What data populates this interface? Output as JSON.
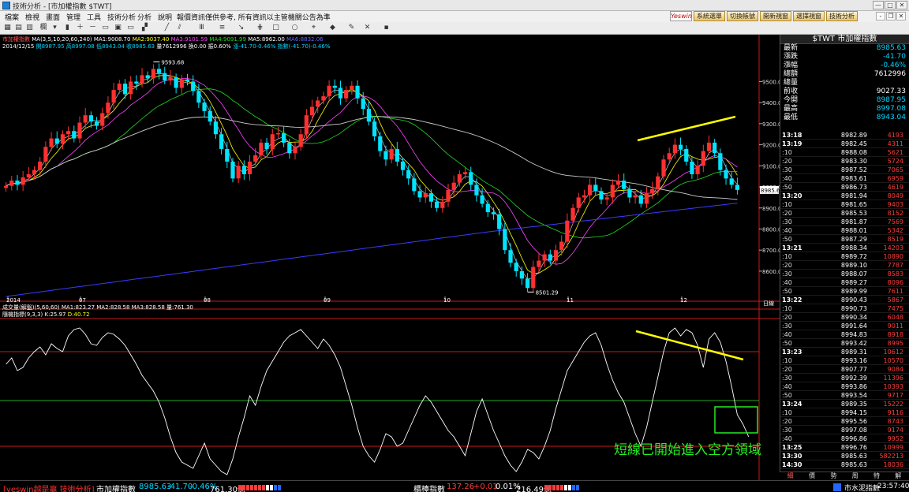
{
  "window": {
    "title": "技術分析 - [市加權指數 $TWT]",
    "buttons": [
      "—",
      "□",
      "✕"
    ]
  },
  "menu": {
    "items": [
      "檔案",
      "檢視",
      "畫面",
      "管理",
      "工具",
      "技術分析",
      "分析",
      "說明"
    ],
    "notice": "報價資訊僅供參考, 所有資訊以主管機關公告為準",
    "brand": "Yeswin",
    "top_buttons": [
      "系統選單",
      "切換帳號",
      "開新視窗",
      "選擇視窗",
      "技術分析"
    ],
    "mdi_buttons": [
      "-",
      "❐",
      "✕"
    ]
  },
  "toolbar": {
    "icons": [
      "grid-icon",
      "table-icon",
      "chart-icon",
      "candle-icon",
      "zoom-in-icon",
      "zoom-out-icon",
      "line-tool-icon",
      "parallel-tool-icon",
      "text-tool-icon",
      "grid-lines-icon",
      "arrow-tool-icon",
      "fibonacci-icon",
      "rect-tool-icon",
      "circle-tool-icon",
      "save-icon"
    ],
    "period_label": "欄"
  },
  "chart_header": {
    "name": "市加權指數",
    "ma_legend": [
      {
        "text": "MA(3,5,10,20,60,240)",
        "color": "#ffffff"
      },
      {
        "text": "MA1:9008.70",
        "color": "#ffffff"
      },
      {
        "text": "MA2:9037.40",
        "color": "#ffff00"
      },
      {
        "text": "MA3:9101.59",
        "color": "#ff44ff"
      },
      {
        "text": "MA4:9091.99",
        "color": "#22dd22"
      },
      {
        "text": "MA5:8962.00",
        "color": "#ffffff"
      },
      {
        "text": "MA6:8832.06",
        "color": "#4444ff"
      }
    ],
    "ohlc": {
      "date": "2014/12/15",
      "open": "開8987.95",
      "high": "高8997.08",
      "low": "低8943.04",
      "close": "收8985.63",
      "volume": "量7612996",
      "turnover": "換0.00",
      "amp": "振0.60%",
      "change": "漲-41.70-0.46%",
      "index_change": "指數(-41.70)-0.46%"
    },
    "volume_legend": [
      {
        "text": "成交量(解盤)(5,60,60)",
        "color": "#ffffff"
      },
      {
        "text": "MA1:823.27",
        "color": "#ffffff"
      },
      {
        "text": "MA2:828.58",
        "color": "#ffffff"
      },
      {
        "text": "MA3:828.58",
        "color": "#ffffff"
      },
      {
        "text": "量:761.30",
        "color": "#ffffff"
      }
    ],
    "kd_legend": [
      {
        "text": "隨機指標(9,3,3)",
        "color": "#ffffff"
      },
      {
        "text": "K:25.97",
        "color": "#ffffff"
      },
      {
        "text": "D:40.72",
        "color": "#ffff00"
      }
    ]
  },
  "chart_data": {
    "type": "candlestick",
    "y_axis": {
      "ticks": [
        9500,
        9400,
        9300,
        9200,
        9100,
        9000,
        8900,
        8800,
        8700,
        8600
      ],
      "labels": [
        "9500.0",
        "9400.0",
        "9300.0",
        "9200.0",
        "9100.0",
        "9000.0",
        "8900.0",
        "8800.0",
        "8700.0",
        "8600.0"
      ],
      "range": [
        8480,
        9640
      ]
    },
    "x_axis": {
      "labels": [
        "2014",
        "07",
        "08",
        "09",
        "10",
        "11",
        "12"
      ],
      "unit_label": "日線"
    },
    "annotations": {
      "high": "9593.68",
      "low": "8501.29",
      "last_price_tag": "8985.63"
    },
    "close": [
      9005,
      9030,
      9010,
      9045,
      9060,
      9080,
      9120,
      9190,
      9230,
      9205,
      9250,
      9265,
      9230,
      9305,
      9340,
      9310,
      9290,
      9350,
      9400,
      9460,
      9490,
      9440,
      9500,
      9490,
      9530,
      9515,
      9560,
      9540,
      9505,
      9520,
      9470,
      9510,
      9500,
      9455,
      9400,
      9360,
      9310,
      9250,
      9180,
      9120,
      9040,
      9100,
      9060,
      9120,
      9150,
      9210,
      9180,
      9250,
      9255,
      9210,
      9160,
      9190,
      9250,
      9340,
      9380,
      9410,
      9430,
      9480,
      9470,
      9420,
      9460,
      9480,
      9420,
      9370,
      9310,
      9240,
      9170,
      9130,
      9180,
      9120,
      9080,
      9040,
      8980,
      8950,
      8970,
      8930,
      8900,
      8930,
      8985,
      9020,
      9060,
      9070,
      9010,
      8960,
      8920,
      8880,
      8870,
      8800,
      8700,
      8640,
      8600,
      8565,
      8520,
      8620,
      8650,
      8680,
      8650,
      8700,
      8740,
      8840,
      8900,
      8950,
      8960,
      9010,
      8980,
      8940,
      8950,
      9010,
      9030,
      8990,
      8950,
      8960,
      8920,
      8970,
      8990,
      9050,
      9130,
      9160,
      9200,
      9180,
      9120,
      9060,
      9100,
      9170,
      9210,
      9160,
      9080,
      9040,
      9010,
      8985.63
    ],
    "series": [
      {
        "name": "MA1",
        "color": "#ffffff"
      },
      {
        "name": "MA2",
        "color": "#ffff00"
      },
      {
        "name": "MA3",
        "color": "#ff44ff"
      },
      {
        "name": "MA4",
        "color": "#22dd22"
      },
      {
        "name": "MA5",
        "color": "#ffffff"
      },
      {
        "name": "MA6",
        "color": "#4444ff"
      }
    ],
    "kd": {
      "range": [
        0,
        100
      ],
      "levels": [
        80,
        50,
        20
      ],
      "k": [
        72,
        76,
        68,
        70,
        76,
        80,
        83,
        78,
        85,
        82,
        80,
        90,
        94,
        95,
        91,
        85,
        84,
        89,
        92,
        91,
        88,
        84,
        78,
        72,
        65,
        60,
        55,
        48,
        38,
        26,
        16,
        10,
        8,
        6,
        14,
        22,
        12,
        8,
        4,
        2,
        12,
        26,
        38,
        52,
        46,
        58,
        68,
        74,
        80,
        86,
        90,
        92,
        94,
        90,
        86,
        82,
        88,
        84,
        78,
        70,
        58,
        46,
        32,
        20,
        14,
        10,
        18,
        28,
        26,
        20,
        22,
        30,
        38,
        46,
        52,
        48,
        42,
        36,
        30,
        26,
        20,
        14,
        28,
        42,
        50,
        40,
        30,
        22,
        14,
        8,
        4,
        10,
        18,
        16,
        12,
        20,
        30,
        44,
        56,
        68,
        74,
        80,
        86,
        90,
        92,
        84,
        72,
        62,
        54,
        48,
        38,
        28,
        20,
        32,
        48,
        64,
        80,
        92,
        95,
        90,
        94,
        92,
        84,
        70,
        88,
        92,
        86,
        74,
        58,
        40,
        34,
        26
      ],
      "last_k": 25.97,
      "last_d": 40.72
    }
  },
  "annotation_text": "短線已開始進入空方領域",
  "right_panel": {
    "title": "$TWT  市加權指數",
    "quotes": [
      {
        "label": "最新",
        "value": "8985.63",
        "color": "#00d7ff"
      },
      {
        "label": "漲跌",
        "value": "-41.70",
        "color": "#00d7ff"
      },
      {
        "label": "漲幅",
        "value": "-0.46%",
        "color": "#00d7ff"
      },
      {
        "label": "總額",
        "value": "7612996",
        "color": "#ffffff"
      },
      {
        "label": "總量",
        "value": "",
        "color": "#ffffff"
      },
      {
        "label": "前收",
        "value": "9027.33",
        "color": "#ffffff"
      },
      {
        "label": "今開",
        "value": "8987.95",
        "color": "#00d7ff"
      },
      {
        "label": "最高",
        "value": "8997.08",
        "color": "#00d7ff"
      },
      {
        "label": "最低",
        "value": "8943.04",
        "color": "#00d7ff"
      }
    ],
    "ticks": [
      {
        "t": "13:18",
        "p": "8982.89",
        "v": "4193",
        "major": true
      },
      {
        "t": "13:19",
        "p": "8982.45",
        "v": "4311",
        "major": true
      },
      {
        "t": ":10",
        "p": "8988.08",
        "v": "5621"
      },
      {
        "t": ":20",
        "p": "8983.30",
        "v": "5724"
      },
      {
        "t": ":30",
        "p": "8987.52",
        "v": "7065"
      },
      {
        "t": ":40",
        "p": "8983.61",
        "v": "6959"
      },
      {
        "t": ":50",
        "p": "8986.73",
        "v": "4619"
      },
      {
        "t": "13:20",
        "p": "8981.94",
        "v": "8049",
        "major": true
      },
      {
        "t": ":10",
        "p": "8981.65",
        "v": "9403"
      },
      {
        "t": ":20",
        "p": "8985.53",
        "v": "8152"
      },
      {
        "t": ":30",
        "p": "8981.87",
        "v": "7569"
      },
      {
        "t": ":40",
        "p": "8988.01",
        "v": "5342"
      },
      {
        "t": ":50",
        "p": "8987.29",
        "v": "8519"
      },
      {
        "t": "13:21",
        "p": "8988.34",
        "v": "14203",
        "major": true
      },
      {
        "t": ":10",
        "p": "8989.72",
        "v": "10890"
      },
      {
        "t": ":20",
        "p": "8989.10",
        "v": "7787"
      },
      {
        "t": ":30",
        "p": "8988.07",
        "v": "8583"
      },
      {
        "t": ":40",
        "p": "8989.27",
        "v": "8096"
      },
      {
        "t": ":50",
        "p": "8989.99",
        "v": "7611"
      },
      {
        "t": "13:22",
        "p": "8990.43",
        "v": "5867",
        "major": true
      },
      {
        "t": ":10",
        "p": "8990.73",
        "v": "7475"
      },
      {
        "t": ":20",
        "p": "8990.34",
        "v": "6048"
      },
      {
        "t": ":30",
        "p": "8991.64",
        "v": "9011"
      },
      {
        "t": ":40",
        "p": "8994.83",
        "v": "8918"
      },
      {
        "t": ":50",
        "p": "8993.42",
        "v": "8995"
      },
      {
        "t": "13:23",
        "p": "8989.31",
        "v": "10612",
        "major": true
      },
      {
        "t": ":10",
        "p": "8993.16",
        "v": "10570"
      },
      {
        "t": ":20",
        "p": "8907.77",
        "v": "9084"
      },
      {
        "t": ":30",
        "p": "8992.39",
        "v": "11396"
      },
      {
        "t": ":40",
        "p": "8993.86",
        "v": "10393"
      },
      {
        "t": ":50",
        "p": "8993.54",
        "v": "9717"
      },
      {
        "t": "13:24",
        "p": "8989.35",
        "v": "15222",
        "major": true
      },
      {
        "t": ":10",
        "p": "8994.15",
        "v": "9116"
      },
      {
        "t": ":20",
        "p": "8995.56",
        "v": "8743"
      },
      {
        "t": ":30",
        "p": "8997.08",
        "v": "9174"
      },
      {
        "t": ":40",
        "p": "8996.86",
        "v": "9952"
      },
      {
        "t": "13:25",
        "p": "8996.76",
        "v": "10999",
        "major": true
      },
      {
        "t": "13:30",
        "p": "8985.63",
        "v": "582213",
        "major": true
      },
      {
        "t": "14:30",
        "p": "8985.63",
        "v": "18036",
        "major": true
      }
    ],
    "tabs": [
      "細",
      "價",
      "勢",
      "周",
      "特",
      "解"
    ]
  },
  "status_bar": {
    "brand": "[yeswin越是贏 技術分析]",
    "index1_name": "市加權指數",
    "index1_value": "8985.63",
    "index1_change": "-41.70",
    "index1_pct": "-0.46%",
    "index1_amount": "761.30億",
    "index2_name": "櫃檯指數",
    "index2_value": "137.26",
    "index2_change": "+0.01",
    "index2_pct": "0.01%",
    "index2_amount": "216.49億",
    "right_text": "市水泥指數",
    "time": "23:57:40"
  }
}
